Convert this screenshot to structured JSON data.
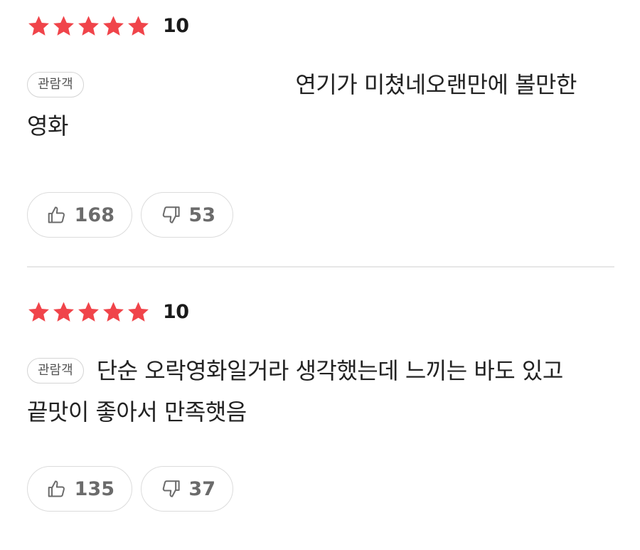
{
  "reviews": [
    {
      "rating": 5,
      "score": "10",
      "badge": "관람객",
      "text": "연기가 미쳤네오랜만에 볼만한 영화",
      "likes": "168",
      "dislikes": "53"
    },
    {
      "rating": 5,
      "score": "10",
      "badge": "관람객",
      "text": "단순 오락영화일거라 생각했는데 느끼는 바도 있고 끝맛이 좋아서 만족햇음",
      "likes": "135",
      "dislikes": "37"
    }
  ],
  "colors": {
    "star": "#f0444a",
    "icon": "#6b6b6b"
  }
}
